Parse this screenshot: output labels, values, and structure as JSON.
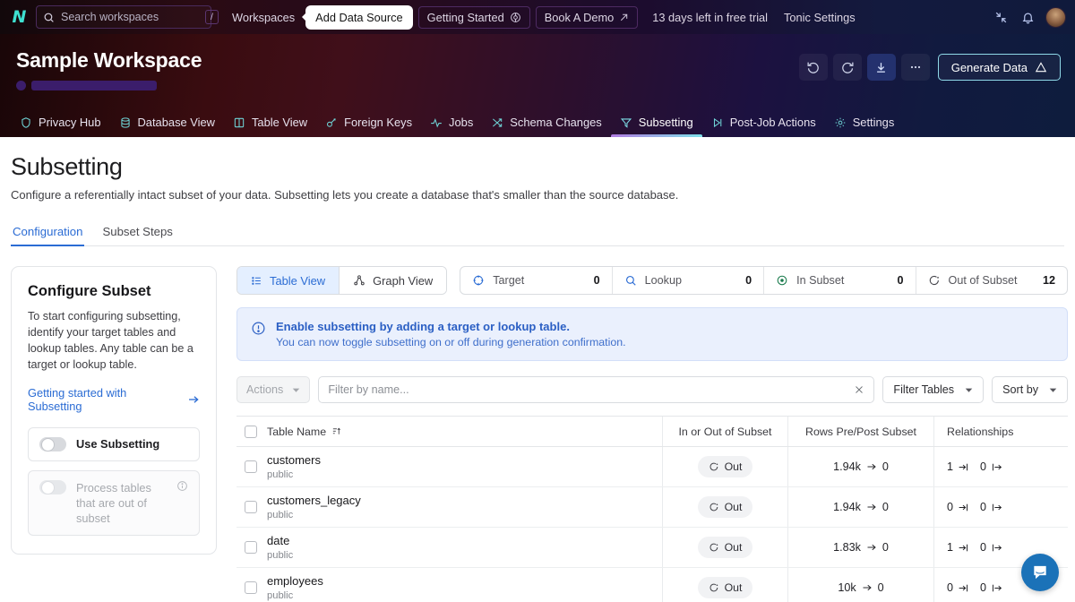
{
  "topbar": {
    "logo": "tonic-logo-icon",
    "search": {
      "placeholder": "Search workspaces",
      "value": "",
      "shortcut": "/"
    },
    "nav": [
      {
        "label": "Workspaces",
        "type": "plain"
      },
      {
        "label": "Add Data Source",
        "type": "active-tab"
      },
      {
        "label": "Getting Started",
        "type": "bordered",
        "icon": "help-badge-icon"
      },
      {
        "label": "Book A Demo",
        "type": "bordered",
        "icon": "external-link-icon"
      },
      {
        "label": "13 days left in free trial",
        "type": "plain"
      },
      {
        "label": "Tonic Settings",
        "type": "plain"
      }
    ],
    "right_icons": [
      "collapse-icon",
      "bell-icon",
      "avatar"
    ]
  },
  "workspace": {
    "title": "Sample Workspace",
    "subtitle_loading": true,
    "actions": {
      "undo": "undo-icon",
      "redo": "redo-icon",
      "download": "download-icon",
      "more": "more-icon",
      "generate_label": "Generate Data"
    },
    "nav": [
      {
        "label": "Privacy Hub",
        "icon": "shield-icon",
        "active": false
      },
      {
        "label": "Database View",
        "icon": "database-icon",
        "active": false
      },
      {
        "label": "Table View",
        "icon": "table-icon",
        "active": false
      },
      {
        "label": "Foreign Keys",
        "icon": "key-icon",
        "active": false
      },
      {
        "label": "Jobs",
        "icon": "activity-icon",
        "active": false
      },
      {
        "label": "Schema Changes",
        "icon": "shuffle-icon",
        "active": false
      },
      {
        "label": "Subsetting",
        "icon": "filter-icon",
        "active": true
      },
      {
        "label": "Post-Job Actions",
        "icon": "skip-icon",
        "active": false
      },
      {
        "label": "Settings",
        "icon": "gear-icon",
        "active": false
      }
    ]
  },
  "page": {
    "title": "Subsetting",
    "description": "Configure a referentially intact subset of your data. Subsetting lets you create a database that's smaller than the source database.",
    "tabs": [
      {
        "label": "Configuration",
        "active": true
      },
      {
        "label": "Subset Steps",
        "active": false
      }
    ]
  },
  "configure_card": {
    "title": "Configure Subset",
    "body": "To start configuring subsetting, identify your target tables and lookup tables. Any table can be a target or lookup table.",
    "link": "Getting started with Subsetting",
    "toggles": [
      {
        "label": "Use Subsetting",
        "on": false,
        "disabled": false
      },
      {
        "label": "Process tables that are out of subset",
        "on": false,
        "disabled": true,
        "info": "info-icon"
      }
    ]
  },
  "view_toggle": [
    {
      "label": "Table View",
      "icon": "list-icon",
      "active": true
    },
    {
      "label": "Graph View",
      "icon": "graph-icon",
      "active": false
    }
  ],
  "stats": [
    {
      "label": "Target",
      "value": "0",
      "icon": "target-icon"
    },
    {
      "label": "Lookup",
      "value": "0",
      "icon": "search-icon"
    },
    {
      "label": "In Subset",
      "value": "0",
      "icon": "in-subset-icon"
    },
    {
      "label": "Out of Subset",
      "value": "12",
      "icon": "out-of-subset-icon"
    }
  ],
  "banner": {
    "icon": "info-circle-icon",
    "title": "Enable subsetting by adding a target or lookup table.",
    "subtitle": "You can now toggle subsetting on or off during generation confirmation."
  },
  "toolbar": {
    "actions_label": "Actions",
    "filter_placeholder": "Filter by name...",
    "filter_value": "",
    "clear_icon": "clear-icon",
    "filter_tables_label": "Filter Tables",
    "sort_by_label": "Sort by"
  },
  "table": {
    "columns": [
      {
        "label": "Table Name",
        "sort_icon": "sort-asc-icon"
      },
      {
        "label": "In or Out of Subset"
      },
      {
        "label": "Rows Pre/Post Subset"
      },
      {
        "label": "Relationships"
      }
    ],
    "rows": [
      {
        "name": "customers",
        "schema": "public",
        "subset": "Out",
        "subset_icon": "out-of-subset-icon",
        "rows_pre": "1.94k",
        "rows_post": "0",
        "rel_in": "1",
        "rel_out": "0"
      },
      {
        "name": "customers_legacy",
        "schema": "public",
        "subset": "Out",
        "subset_icon": "out-of-subset-icon",
        "rows_pre": "1.94k",
        "rows_post": "0",
        "rel_in": "0",
        "rel_out": "0"
      },
      {
        "name": "date",
        "schema": "public",
        "subset": "Out",
        "subset_icon": "out-of-subset-icon",
        "rows_pre": "1.83k",
        "rows_post": "0",
        "rel_in": "1",
        "rel_out": "0"
      },
      {
        "name": "employees",
        "schema": "public",
        "subset": "Out",
        "subset_icon": "out-of-subset-icon",
        "rows_pre": "10k",
        "rows_post": "0",
        "rel_in": "0",
        "rel_out": "0"
      }
    ]
  },
  "chat": {
    "icon": "chat-bubble-icon"
  },
  "colors": {
    "accent_blue": "#2b6cd4",
    "teal": "#3ee0d0",
    "banner_bg": "#eaf0fd",
    "chat_blue": "#1b72b8"
  }
}
